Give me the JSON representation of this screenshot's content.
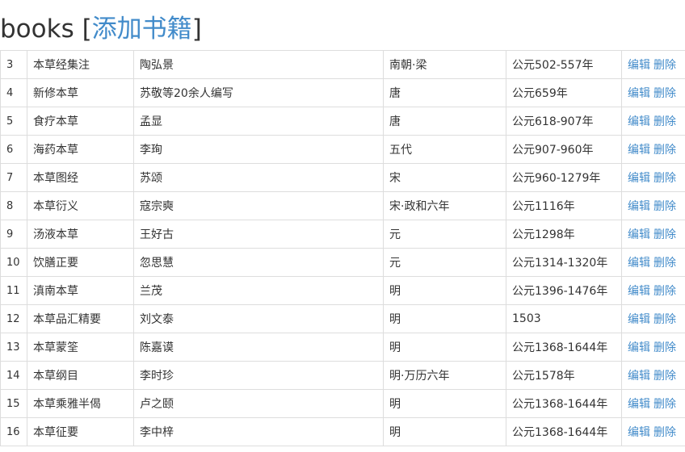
{
  "header": {
    "title": "books",
    "bracket_open": "[",
    "add_link": "添加书籍",
    "bracket_close": "]"
  },
  "actions": {
    "edit": "编辑",
    "delete": "删除"
  },
  "books": [
    {
      "id": "3",
      "name": "本草经集注",
      "author": "陶弘景",
      "dynasty": "南朝·梁",
      "period": "公元502-557年"
    },
    {
      "id": "4",
      "name": "新修本草",
      "author": "苏敬等20余人编写",
      "dynasty": "唐",
      "period": "公元659年"
    },
    {
      "id": "5",
      "name": "食疗本草",
      "author": "孟显",
      "dynasty": "唐",
      "period": "公元618-907年"
    },
    {
      "id": "6",
      "name": "海药本草",
      "author": "李珣",
      "dynasty": "五代",
      "period": "公元907-960年"
    },
    {
      "id": "7",
      "name": "本草图经",
      "author": "苏颂",
      "dynasty": "宋",
      "period": "公元960-1279年"
    },
    {
      "id": "8",
      "name": "本草衍义",
      "author": "寇宗奭",
      "dynasty": "宋·政和六年",
      "period": "公元1116年"
    },
    {
      "id": "9",
      "name": "汤液本草",
      "author": "王好古",
      "dynasty": "元",
      "period": "公元1298年"
    },
    {
      "id": "10",
      "name": "饮膳正要",
      "author": "忽思慧",
      "dynasty": "元",
      "period": "公元1314-1320年"
    },
    {
      "id": "11",
      "name": "滇南本草",
      "author": "兰茂",
      "dynasty": "明",
      "period": "公元1396-1476年"
    },
    {
      "id": "12",
      "name": "本草品汇精要",
      "author": "刘文泰",
      "dynasty": "明",
      "period": "1503"
    },
    {
      "id": "13",
      "name": "本草蒙筌",
      "author": "陈嘉谟",
      "dynasty": "明",
      "period": "公元1368-1644年"
    },
    {
      "id": "14",
      "name": "本草纲目",
      "author": "李时珍",
      "dynasty": "明·万历六年",
      "period": "公元1578年"
    },
    {
      "id": "15",
      "name": "本草乘雅半偈",
      "author": "卢之颐",
      "dynasty": "明",
      "period": "公元1368-1644年"
    },
    {
      "id": "16",
      "name": "本草征要",
      "author": "李中梓",
      "dynasty": "明",
      "period": "公元1368-1644年"
    }
  ]
}
